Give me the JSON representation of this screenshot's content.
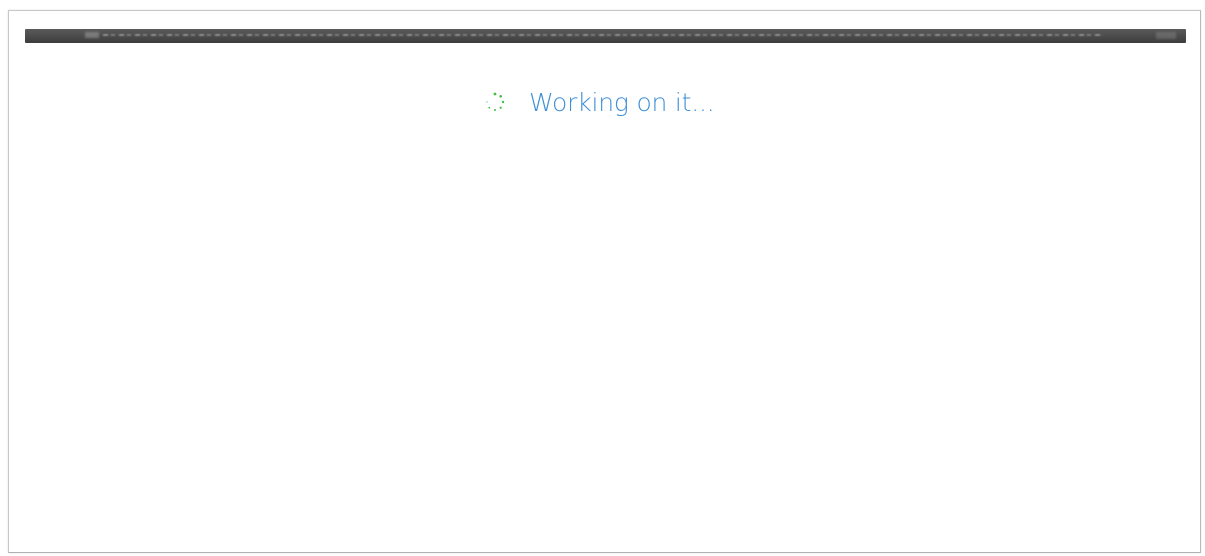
{
  "status": {
    "loading_text": "Working on it..."
  },
  "icons": {
    "spinner": "loading-spinner-icon"
  },
  "colors": {
    "loading_text": "#3d8fd6",
    "spinner": "#3fbf3f",
    "address_bar": "#4a4a4a"
  }
}
